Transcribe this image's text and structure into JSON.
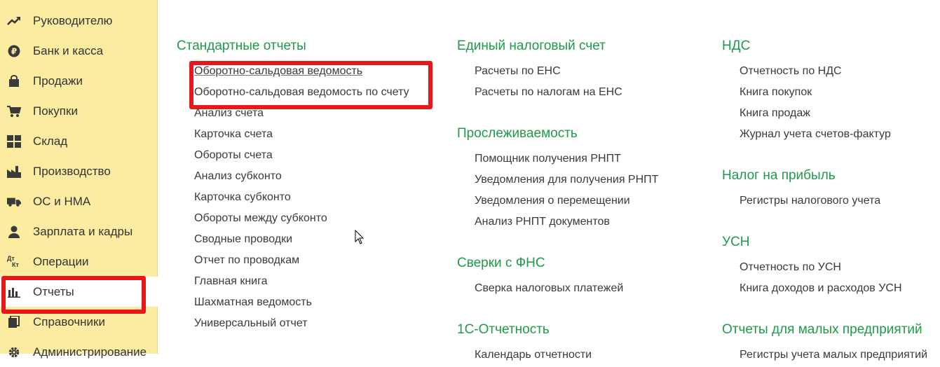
{
  "sidebar": {
    "items": [
      {
        "label": "Руководителю",
        "icon": "trend-up-icon"
      },
      {
        "label": "Банк и касса",
        "icon": "ruble-coin-icon"
      },
      {
        "label": "Продажи",
        "icon": "shopping-bag-icon"
      },
      {
        "label": "Покупки",
        "icon": "cart-icon"
      },
      {
        "label": "Склад",
        "icon": "warehouse-grid-icon"
      },
      {
        "label": "Производство",
        "icon": "factory-icon"
      },
      {
        "label": "ОС и НМА",
        "icon": "truck-icon"
      },
      {
        "label": "Зарплата и кадры",
        "icon": "person-icon"
      },
      {
        "label": "Операции",
        "icon": "dt-kt-icon",
        "icon_text": [
          "Дт",
          "Кт"
        ]
      },
      {
        "label": "Отчеты",
        "icon": "bar-chart-icon",
        "active": true
      },
      {
        "label": "Справочники",
        "icon": "books-icon"
      },
      {
        "label": "Администрирование",
        "icon": "gear-icon"
      }
    ]
  },
  "sections": {
    "standard": {
      "title": "Стандартные отчеты",
      "links": [
        "Оборотно-сальдовая ведомость",
        "Оборотно-сальдовая ведомость по счету",
        "Анализ счета",
        "Карточка счета",
        "Обороты счета",
        "Анализ субконто",
        "Карточка субконто",
        "Обороты между субконто",
        "Сводные проводки",
        "Отчет по проводкам",
        "Главная книга",
        "Шахматная ведомость",
        "Универсальный отчет"
      ]
    },
    "ens": {
      "title": "Единый налоговый счет",
      "links": [
        "Расчеты по ЕНС",
        "Расчеты по налогам на ЕНС"
      ]
    },
    "tracing": {
      "title": "Прослеживаемость",
      "links": [
        "Помощник получения РНПТ",
        "Уведомления для получения РНПТ",
        "Уведомления о перемещении",
        "Анализ РНПТ документов"
      ]
    },
    "fns": {
      "title": "Сверки с ФНС",
      "links": [
        "Сверка налоговых платежей"
      ]
    },
    "reporting": {
      "title": "1С-Отчетность",
      "links": [
        "Календарь отчетности"
      ]
    },
    "vat": {
      "title": "НДС",
      "links": [
        "Отчетность по НДС",
        "Книга покупок",
        "Книга продаж",
        "Журнал учета счетов-фактур"
      ]
    },
    "profit": {
      "title": "Налог на прибыль",
      "links": [
        "Регистры налогового учета"
      ]
    },
    "usn": {
      "title": "УСН",
      "links": [
        "Отчетность по УСН",
        "Книга доходов и расходов УСН"
      ]
    },
    "small": {
      "title": "Отчеты для малых предприятий",
      "links": [
        "Регистры учета малых предприятий"
      ]
    }
  },
  "colors": {
    "sidebar_bg": "#fbeca2",
    "section_title": "#1f9a4a",
    "highlight_box": "#e8171b"
  }
}
